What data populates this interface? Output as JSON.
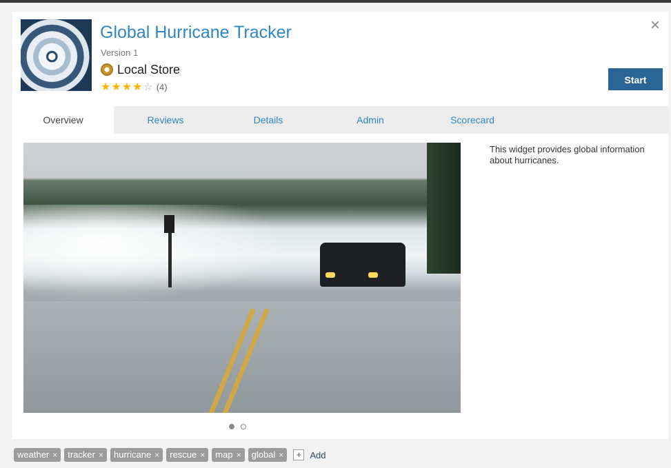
{
  "header": {
    "title": "Global Hurricane Tracker",
    "version": "Version 1",
    "store": "Local Store",
    "rating": {
      "stars": 4,
      "max": 5,
      "count": "(4)"
    },
    "close_label": "×",
    "start_label": "Start"
  },
  "tabs": [
    {
      "label": "Overview",
      "active": true
    },
    {
      "label": "Reviews"
    },
    {
      "label": "Details"
    },
    {
      "label": "Admin"
    },
    {
      "label": "Scorecard"
    }
  ],
  "overview": {
    "description": "This widget provides global information about hurricanes.",
    "carousel": {
      "current": 1,
      "total": 2
    }
  },
  "tags": {
    "items": [
      "weather",
      "tracker",
      "hurricane",
      "rescue",
      "map",
      "global"
    ],
    "remove_glyph": "×",
    "add_glyph": "+",
    "add_label": "Add"
  },
  "colors": {
    "title": "#2f87c3",
    "start_button": "#2a6595",
    "star": "#f2b600",
    "tag": "#9b9b9b"
  }
}
